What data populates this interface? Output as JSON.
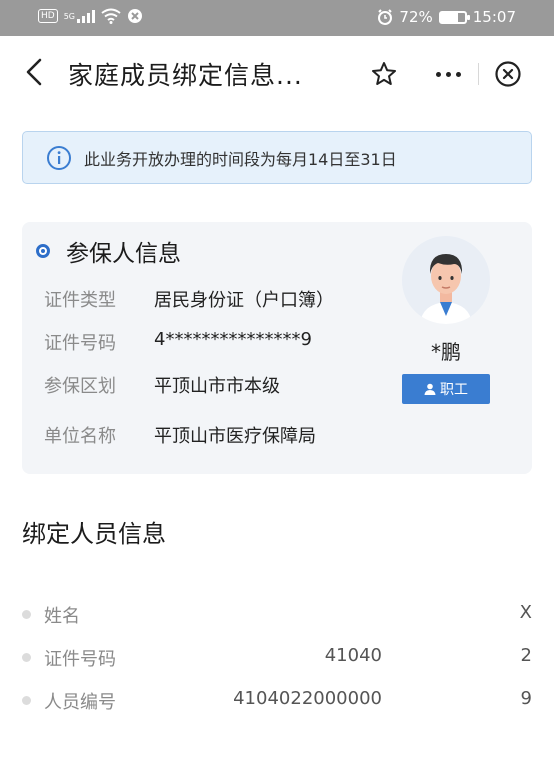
{
  "status_bar": {
    "hd_badge": "HD",
    "network": "5G",
    "battery_percent": "72%",
    "battery_level": 0.72,
    "time": "15:07"
  },
  "header": {
    "title": "家庭成员绑定信息...",
    "icons": [
      "back-icon",
      "star-icon",
      "more-icon",
      "close-icon"
    ]
  },
  "notice": {
    "text": "此业务开放办理的时间段为每月14日至31日",
    "color": "#e6f1fb"
  },
  "insured": {
    "title": "参保人信息",
    "rows": [
      {
        "label": "证件类型",
        "value": "居民身份证（户口簿）"
      },
      {
        "label": "证件号码",
        "value": "4***************9"
      },
      {
        "label": "参保区划",
        "value": "平顶山市市本级"
      },
      {
        "label": "单位名称",
        "value": "平顶山市医疗保障局"
      }
    ],
    "name": "*鹏",
    "role": "职工",
    "accent": "#3a7dd1"
  },
  "bound": {
    "title": "绑定人员信息",
    "rows": [
      {
        "label": "姓名",
        "mid": "",
        "end": "X"
      },
      {
        "label": "证件号码",
        "mid": "41040",
        "end": "2"
      },
      {
        "label": "人员编号",
        "mid": "4104022000000",
        "end": "9"
      }
    ]
  }
}
